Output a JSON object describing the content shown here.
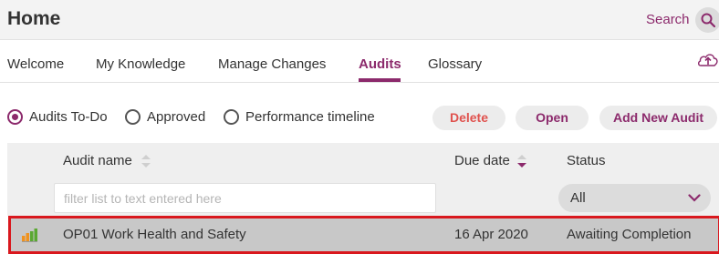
{
  "header": {
    "title": "Home",
    "search_label": "Search"
  },
  "tabs": [
    {
      "label": "Welcome"
    },
    {
      "label": "My Knowledge"
    },
    {
      "label": "Manage Changes"
    },
    {
      "label": "Audits",
      "active": true
    },
    {
      "label": "Glossary"
    }
  ],
  "filters": {
    "radios": [
      {
        "label": "Audits To-Do",
        "selected": true
      },
      {
        "label": "Approved",
        "selected": false
      },
      {
        "label": "Performance timeline",
        "selected": false
      }
    ]
  },
  "actions": {
    "delete_label": "Delete",
    "open_label": "Open",
    "add_label": "Add New Audit"
  },
  "colors": {
    "accent": "#8c2a6c",
    "delete": "#e0524e",
    "selection_outline": "#d9181e",
    "icon_green": "#5aa832",
    "icon_orange": "#f0921e"
  },
  "table": {
    "columns": [
      {
        "label": "Audit name"
      },
      {
        "label": "Due date"
      },
      {
        "label": "Status"
      }
    ],
    "filter_placeholder": "filter list to text entered here",
    "status_filter_value": "All",
    "rows": [
      {
        "icon": "bar-chart-icon",
        "name": "OP01 Work Health and Safety",
        "due": "16 Apr 2020",
        "status": "Awaiting Completion",
        "selected": true
      }
    ]
  }
}
